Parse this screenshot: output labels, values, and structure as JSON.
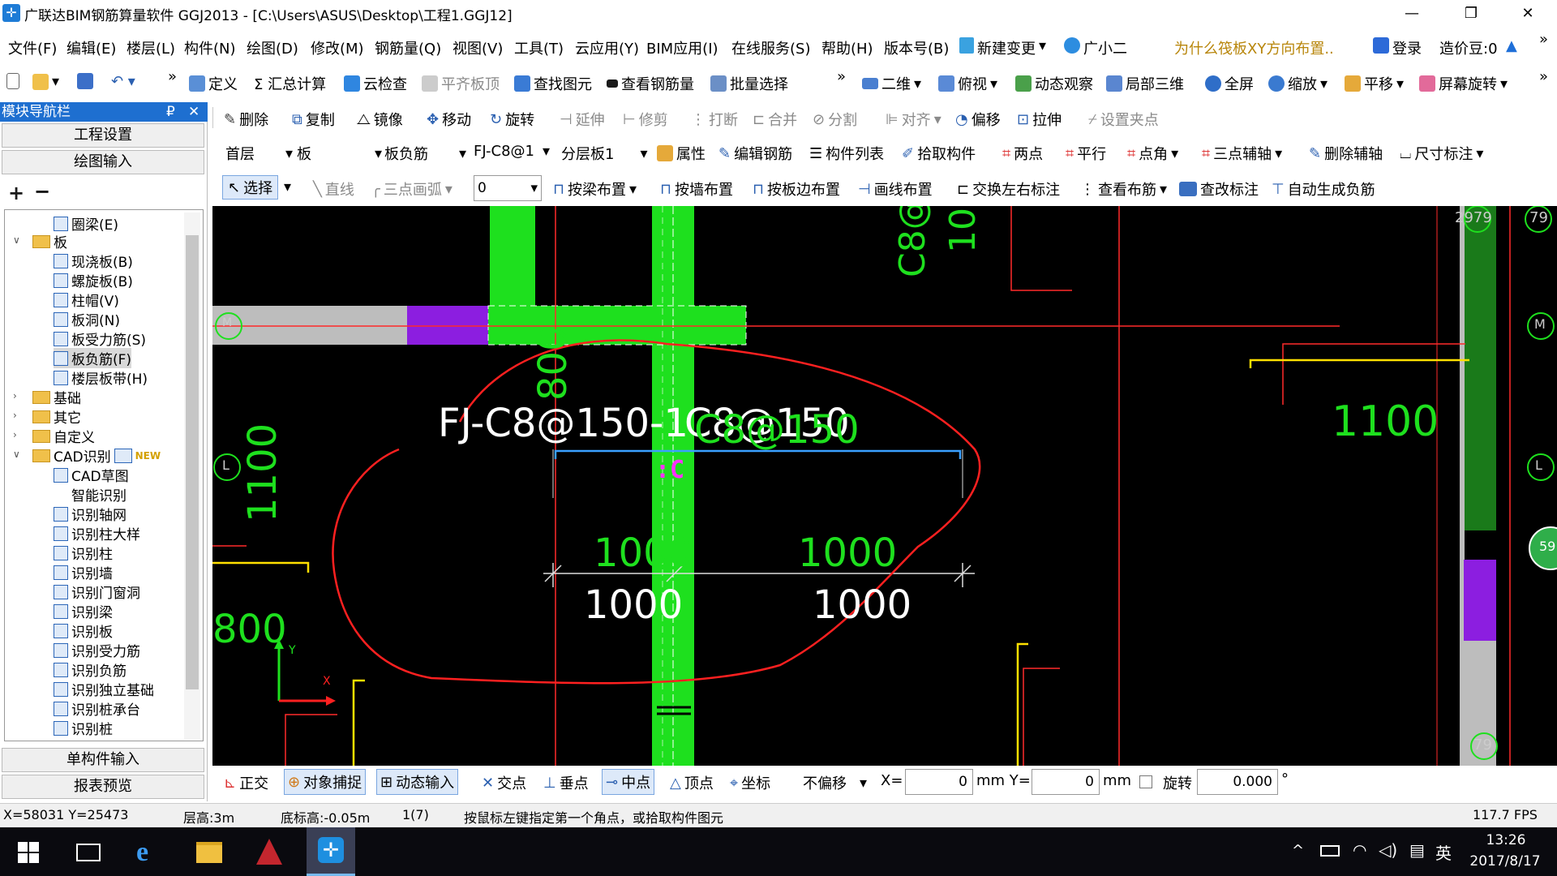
{
  "window": {
    "title": "广联达BIM钢筋算量软件 GGJ2013 - [C:\\Users\\ASUS\\Desktop\\工程1.GGJ12]",
    "min": "—",
    "restore": "❐",
    "close": "✕"
  },
  "menu": {
    "items": [
      "文件(F)",
      "编辑(E)",
      "楼层(L)",
      "构件(N)",
      "绘图(D)",
      "修改(M)",
      "钢筋量(Q)",
      "视图(V)",
      "工具(T)",
      "云应用(Y)",
      "BIM应用(I)",
      "在线服务(S)",
      "帮助(H)",
      "版本号(B)",
      "新建变更",
      "广小二"
    ],
    "hint": "为什么筏板XY方向布置..",
    "login": "登录",
    "price": "造价豆:0",
    "more": "»"
  },
  "toolbar1": {
    "items": [
      "定义",
      "Σ 汇总计算",
      "云检查",
      "平齐板顶",
      "查找图元",
      "查看钢筋量",
      "批量选择",
      "二维",
      "俯视",
      "动态观察",
      "局部三维",
      "全屏",
      "缩放",
      "平移",
      "屏幕旋转"
    ],
    "more": "»"
  },
  "toolbar2": {
    "items": [
      "删除",
      "复制",
      "镜像",
      "移动",
      "旋转",
      "延伸",
      "修剪",
      "打断",
      "合并",
      "分割",
      "对齐",
      "偏移",
      "拉伸",
      "设置夹点"
    ]
  },
  "toolbar3": {
    "floor": "首层",
    "type": "板",
    "subtype": "板负筋",
    "name": "FJ-C8@1",
    "layer": "分层板1",
    "items": [
      "属性",
      "编辑钢筋",
      "构件列表",
      "拾取构件",
      "两点",
      "平行",
      "点角",
      "三点辅轴",
      "删除辅轴",
      "尺寸标注"
    ]
  },
  "toolbar4": {
    "select": "选择",
    "items": [
      "直线",
      "三点画弧",
      "按梁布置",
      "按墙布置",
      "按板边布置",
      "画线布置",
      "交换左右标注",
      "查看布筋",
      "查改标注",
      "自动生成负筋"
    ],
    "value": "0"
  },
  "nav": {
    "title": "模块导航栏",
    "pin": "₽",
    "close": "✕",
    "btn_project": "工程设置",
    "btn_draw": "绘图输入",
    "btn_single": "单构件输入",
    "btn_report": "报表预览",
    "add": "+",
    "remove": "−",
    "tree": [
      "圈梁(E)",
      "板",
      "现浇板(B)",
      "螺旋板(B)",
      "柱帽(V)",
      "板洞(N)",
      "板受力筋(S)",
      "板负筋(F)",
      "楼层板带(H)",
      "基础",
      "其它",
      "自定义",
      "CAD识别",
      "CAD草图",
      "智能识别",
      "识别轴网",
      "识别柱大样",
      "识别柱",
      "识别墙",
      "识别门窗洞",
      "识别梁",
      "识别板",
      "识别受力筋",
      "识别负筋",
      "识别独立基础",
      "识别桩承台",
      "识别桩"
    ],
    "new_badge": "NEW"
  },
  "cad": {
    "label_main": "FJ-C8@150-1",
    "label_overlap": "C8@150",
    "top_vert": "800",
    "left_vert": "1100",
    "dim_green_left": "1000",
    "dim_green_right": "1000",
    "dim_white_left": "1000",
    "dim_white_right": "1000",
    "right_val": "1100",
    "bottom_left": "800",
    "top_right_vert": "C8@",
    "top_right_vert2": "10",
    "axis_m": "M",
    "axis_l": "L",
    "axis_79": "79",
    "axis_2979": "2979",
    "circle_59": "59",
    "y_axis": "Y",
    "x_axis": "X"
  },
  "bottom": {
    "items": [
      "正交",
      "对象捕捉",
      "动态输入",
      "交点",
      "垂点",
      "中点",
      "顶点",
      "坐标"
    ],
    "offset": "不偏移",
    "x_label": "X=",
    "x_val": "0",
    "y_label": "mm Y=",
    "y_val": "0",
    "mm": "mm",
    "rotate": "旋转",
    "rot_val": "0.000",
    "deg": "°"
  },
  "status": {
    "coords": "X=58031 Y=25473",
    "floor_h": "层高:3m",
    "base_h": "底标高:-0.05m",
    "count": "1(7)",
    "hint": "按鼠标左键指定第一个角点，或拾取构件图元",
    "fps": "117.7 FPS"
  },
  "taskbar": {
    "time": "13:26",
    "date": "2017/8/17",
    "ime": "英"
  }
}
